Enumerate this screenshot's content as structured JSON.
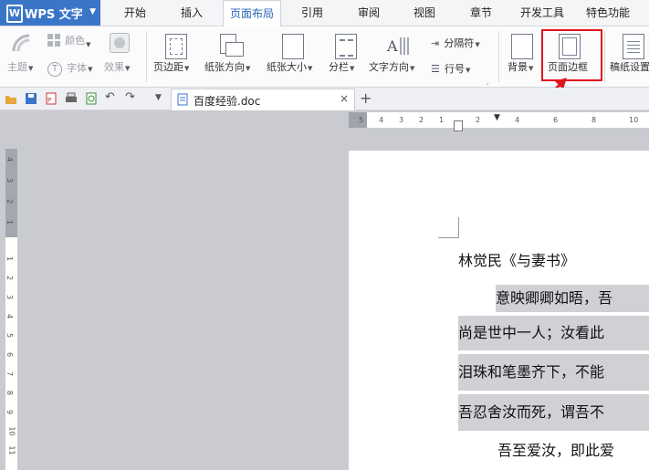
{
  "app": {
    "name": "WPS 文字"
  },
  "menu": {
    "tabs": [
      "开始",
      "插入",
      "页面布局",
      "引用",
      "审阅",
      "视图",
      "章节",
      "开发工具",
      "特色功能"
    ],
    "active_tab": "页面布局"
  },
  "ribbon": {
    "theme": "主题",
    "colors": "颜色",
    "fonts": "字体",
    "effects": "效果",
    "margins": "页边距",
    "orientation": "纸张方向",
    "size": "纸张大小",
    "columns": "分栏",
    "text_direction": "文字方向",
    "breaks": "分隔符",
    "line_numbers": "行号",
    "background": "背景",
    "page_border": "页面边框",
    "manuscript": "稿纸设置"
  },
  "document_tab": {
    "filename": "百度经验.doc"
  },
  "ruler": {
    "h_numbers": [
      "5",
      "4",
      "3",
      "2",
      "1",
      "",
      "2",
      "4",
      "6",
      "8",
      "10"
    ],
    "v_numbers": [
      "4",
      "3",
      "2",
      "1",
      "",
      "1",
      "2",
      "3",
      "4",
      "5",
      "6",
      "7",
      "8",
      "9",
      "10",
      "11"
    ]
  },
  "document": {
    "title": "林觉民《与妻书》",
    "lines": [
      "意映卿卿如晤，吾",
      "尚是世中一人；汝看此",
      "泪珠和笔墨齐下，不能",
      "吾忍舍汝而死，谓吾不",
      "吾至爱汝，即此爱"
    ]
  },
  "colors": {
    "accent": "#3a76c8",
    "highlight_box": "#e0141c"
  }
}
